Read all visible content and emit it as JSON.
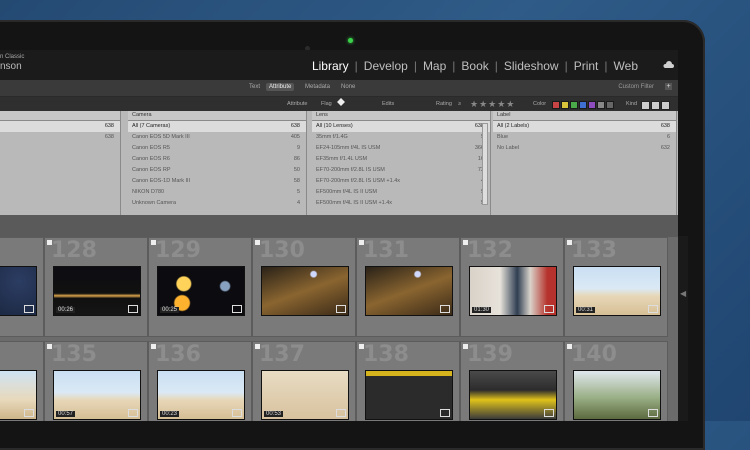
{
  "app": {
    "brand_line1": "n Classic",
    "brand_line2": "nson"
  },
  "modules": [
    {
      "label": "Library",
      "active": true
    },
    {
      "label": "Develop"
    },
    {
      "label": "Map"
    },
    {
      "label": "Book"
    },
    {
      "label": "Slideshow"
    },
    {
      "label": "Print"
    },
    {
      "label": "Web"
    }
  ],
  "filter_bar": {
    "text": "Text",
    "attribute": "Attribute",
    "metadata": "Metadata",
    "none": "None",
    "custom_filter": "Custom Filter"
  },
  "attribute_bar": {
    "attribute_label": "Attribute",
    "flag_label": "Flag",
    "edits_label": "Edits",
    "rating_label": "Rating",
    "rating_op": "≥",
    "color_label": "Color",
    "kind_label": "Kind",
    "colors": [
      "#c94444",
      "#d8c43a",
      "#4aaa4a",
      "#3f6fd0",
      "#8e4dbf",
      "#888888",
      "#666666"
    ]
  },
  "metadata_columns": {
    "left": {
      "header": "",
      "rows": [
        {
          "label": "",
          "count": "638"
        },
        {
          "label": "",
          "count": "638"
        }
      ]
    },
    "cameras": {
      "header": "Camera",
      "rows": [
        {
          "label": "All (7 Cameras)",
          "count": "638"
        },
        {
          "label": "Canon EOS 5D Mark III",
          "count": "405"
        },
        {
          "label": "Canon EOS R5",
          "count": "9"
        },
        {
          "label": "Canon EOS R6",
          "count": "86"
        },
        {
          "label": "Canon EOS RP",
          "count": "50"
        },
        {
          "label": "Canon EOS-1D Mark III",
          "count": "58"
        },
        {
          "label": "NIKON D780",
          "count": "5"
        },
        {
          "label": "Unknown Camera",
          "count": "4"
        }
      ]
    },
    "lens": {
      "header": "Lens",
      "rows": [
        {
          "label": "All (10 Lenses)",
          "count": "638"
        },
        {
          "label": "35mm f/1.4G",
          "count": "5"
        },
        {
          "label": "EF24-105mm f/4L IS USM",
          "count": "366"
        },
        {
          "label": "EF35mm f/1.4L USM",
          "count": "16"
        },
        {
          "label": "EF70-200mm f/2.8L IS USM",
          "count": "73"
        },
        {
          "label": "EF70-200mm f/2.8L IS USM +1.4x",
          "count": "4"
        },
        {
          "label": "EF500mm f/4L IS II USM",
          "count": "5"
        },
        {
          "label": "EF500mm f/4L IS II USM +1.4x",
          "count": "5"
        }
      ]
    },
    "label": {
      "header": "Label",
      "rows": [
        {
          "label": "All (2 Labels)",
          "count": "638"
        },
        {
          "label": "Blue",
          "count": "6"
        },
        {
          "label": "No Label",
          "count": "632"
        }
      ]
    }
  },
  "grid": {
    "cells": [
      {
        "num": "",
        "duration": "",
        "kind": "night-partial"
      },
      {
        "num": "128",
        "duration": "00:26",
        "kind": "harbor"
      },
      {
        "num": "129",
        "duration": "00:25",
        "kind": "bokeh"
      },
      {
        "num": "130",
        "duration": "",
        "kind": "street"
      },
      {
        "num": "131",
        "duration": "",
        "kind": "street"
      },
      {
        "num": "132",
        "duration": "01:30",
        "kind": "child"
      },
      {
        "num": "133",
        "duration": "00:31",
        "kind": "beach"
      },
      {
        "num": "",
        "duration": "",
        "kind": "beach-partial"
      },
      {
        "num": "135",
        "duration": "00:57",
        "kind": "beach"
      },
      {
        "num": "136",
        "duration": "00:23",
        "kind": "beach"
      },
      {
        "num": "137",
        "duration": "00:53",
        "kind": "sand"
      },
      {
        "num": "138",
        "duration": "",
        "kind": "machine"
      },
      {
        "num": "139",
        "duration": "",
        "kind": "machine2"
      },
      {
        "num": "140",
        "duration": "",
        "kind": "park"
      }
    ]
  }
}
